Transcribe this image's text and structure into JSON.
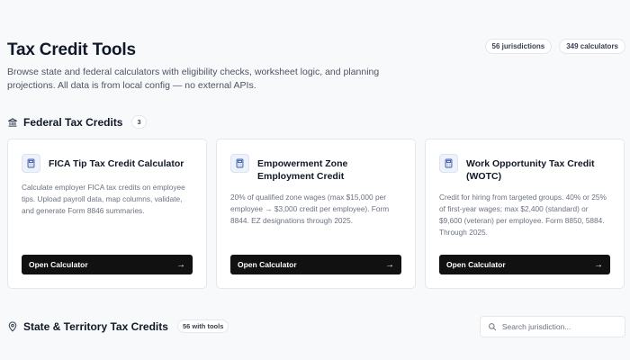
{
  "header": {
    "title": "Tax Credit Tools",
    "subtitle": "Browse state and federal calculators with eligibility checks, worksheet logic, and planning projections. All data is from local config — no external APIs.",
    "badges": [
      "56 jurisdictions",
      "349 calculators"
    ]
  },
  "federal": {
    "title": "Federal Tax Credits",
    "count": "3",
    "icon": "bank-icon",
    "cards": [
      {
        "title": "FICA Tip Tax Credit Calculator",
        "description": "Calculate employer FICA tax credits on employee tips. Upload payroll data, map columns, validate, and generate Form 8846 summaries.",
        "button": "Open Calculator",
        "icon": "calculator-icon"
      },
      {
        "title": "Empowerment Zone Employment Credit",
        "description": "20% of qualified zone wages (max $15,000 per employee → $3,000 credit per employee). Form 8844. EZ designations through 2025.",
        "button": "Open Calculator",
        "icon": "calculator-icon"
      },
      {
        "title": "Work Opportunity Tax Credit (WOTC)",
        "description": "Credit for hiring from targeted groups. 40% or 25% of first-year wages; max $2,400 (standard) or $9,600 (veteran) per employee. Form 8850, 5884. Through 2025.",
        "button": "Open Calculator",
        "icon": "calculator-icon"
      }
    ]
  },
  "state": {
    "title": "State & Territory Tax Credits",
    "count": "56 with tools",
    "icon": "map-pin-icon",
    "search": {
      "placeholder": "Search jurisdiction...",
      "value": ""
    }
  }
}
